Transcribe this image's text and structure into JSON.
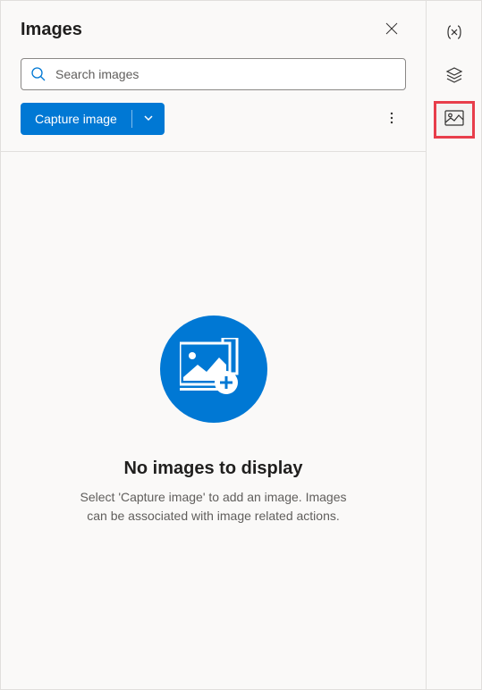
{
  "panel": {
    "title": "Images",
    "search_placeholder": "Search images",
    "capture_label": "Capture image"
  },
  "empty_state": {
    "title": "No images to display",
    "description": "Select 'Capture image' to add an image. Images can be associated with image related actions."
  },
  "rail": {
    "items": [
      {
        "name": "variables",
        "selected": false
      },
      {
        "name": "layers",
        "selected": false
      },
      {
        "name": "images",
        "selected": true
      }
    ]
  }
}
